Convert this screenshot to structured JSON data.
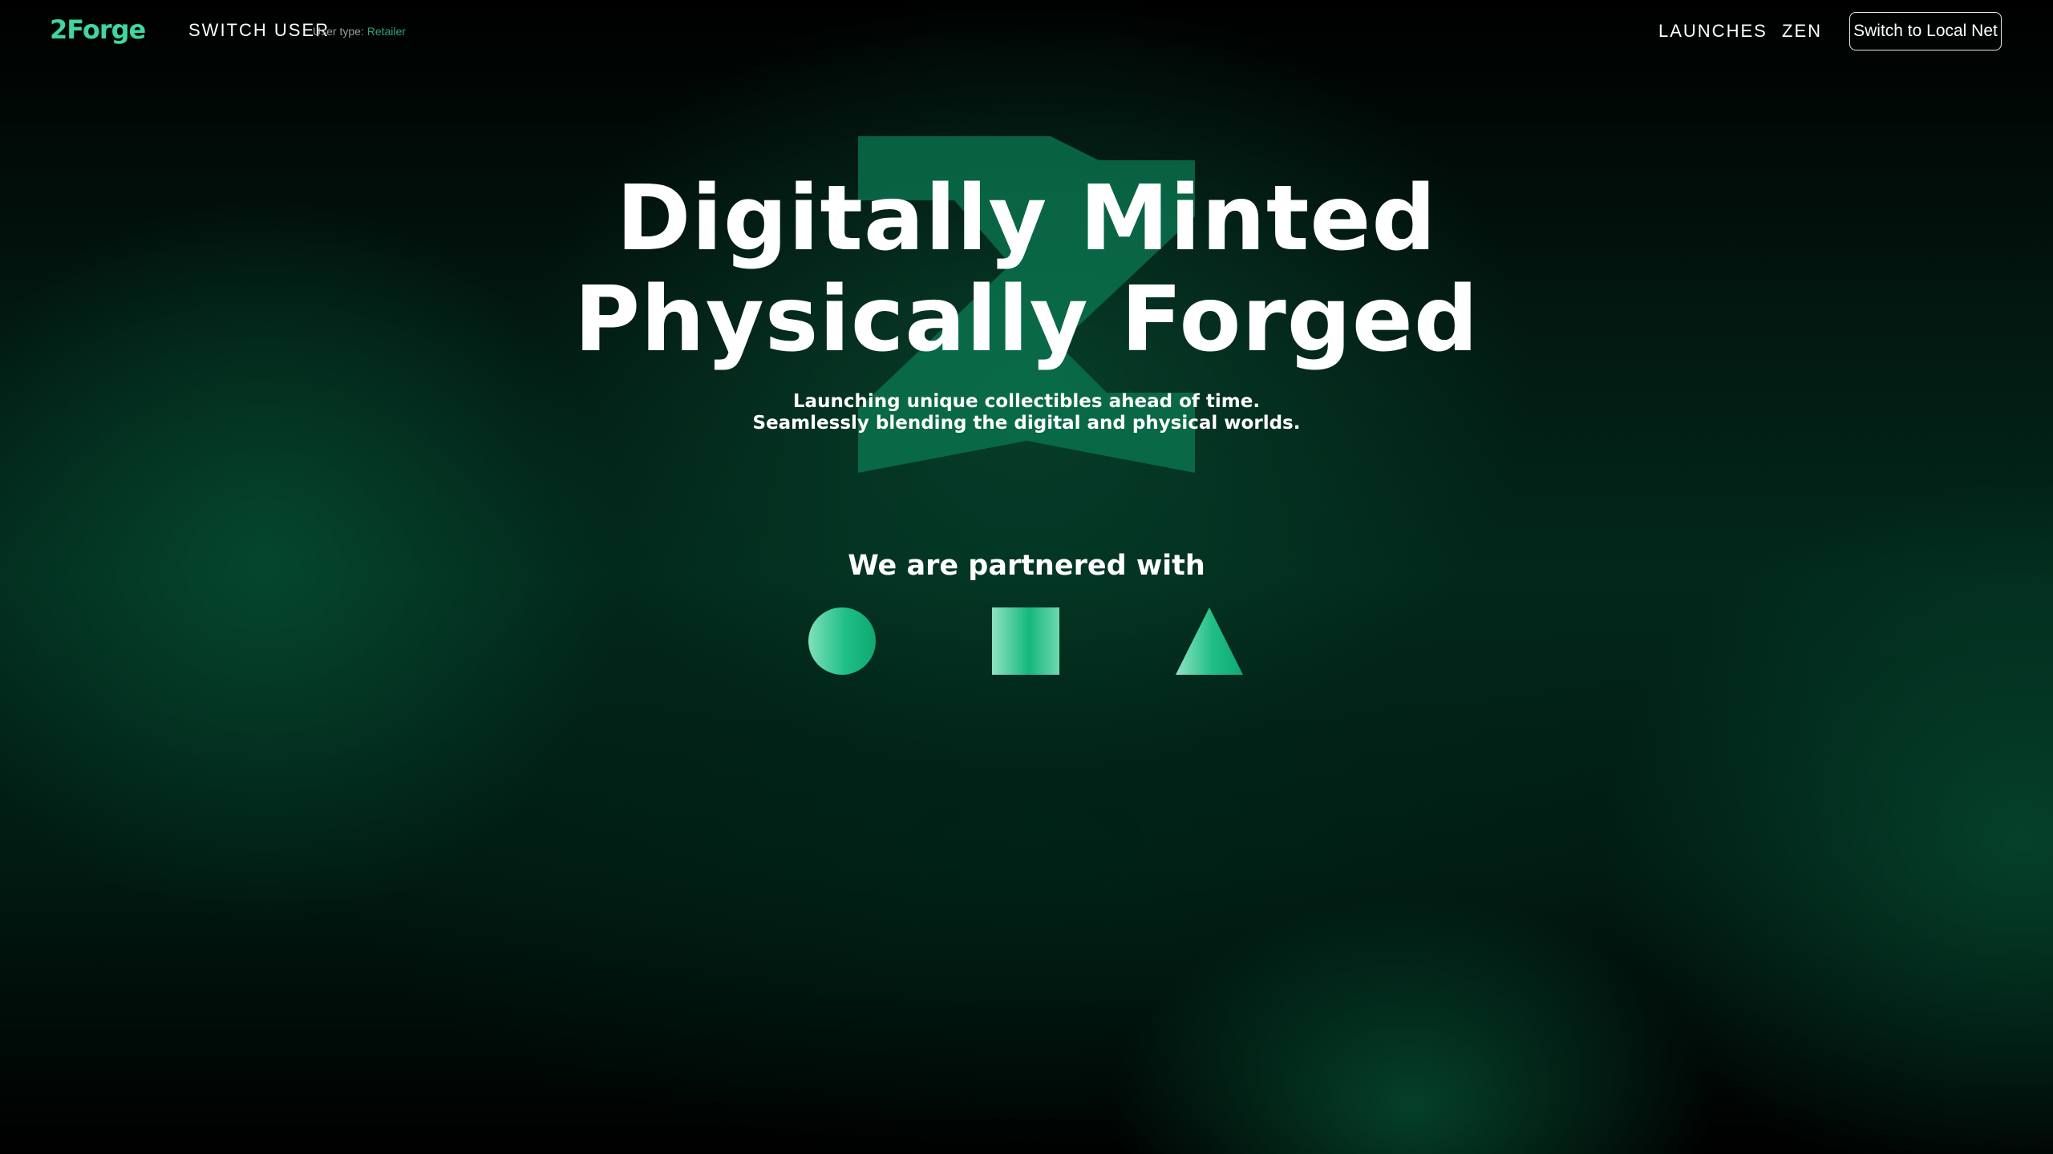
{
  "nav": {
    "logo": "2Forge",
    "switch_user_label": "SWITCH USER",
    "user_type_label": "User type:",
    "user_type_value": "Retailer",
    "links": [
      {
        "label": "LAUNCHES"
      },
      {
        "label": "ZEN"
      }
    ],
    "network_button": "Switch to Local Net"
  },
  "hero": {
    "title_line1": "Digitally Minted",
    "title_line2": "Physically Forged",
    "subtitle_line1": "Launching unique collectibles ahead of time.",
    "subtitle_line2": "Seamlessly blending the digital and physical worlds."
  },
  "partners": {
    "heading": "We are partnered with",
    "logos": [
      {
        "icon": "circle-partner-icon"
      },
      {
        "icon": "square-partner-icon"
      },
      {
        "icon": "triangle-partner-icon"
      }
    ]
  },
  "colors": {
    "accent": "#3fd6a0",
    "background": "#000000",
    "user_type_value": "#2fa37a"
  }
}
